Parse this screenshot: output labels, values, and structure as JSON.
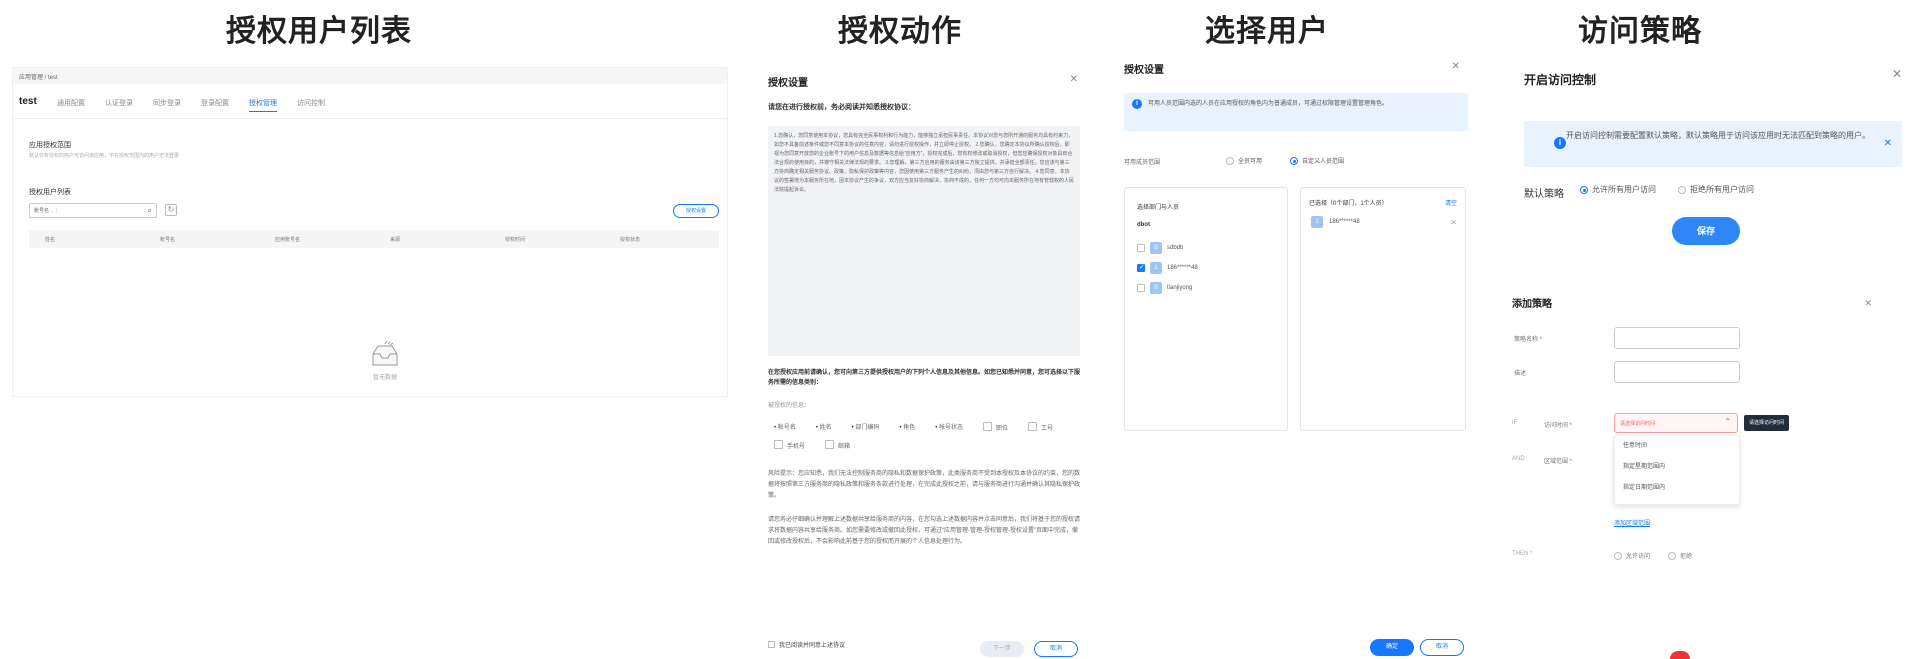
{
  "titles": {
    "p1": "授权用户列表",
    "p2": "授权动作",
    "p3": "选择用户",
    "p4": "访问策略"
  },
  "panel1": {
    "breadcrumb": "应用管理 / test",
    "app_title": "test",
    "tabs": [
      "通用配置",
      "认证登录",
      "同步登录",
      "登录配置",
      "授权管理",
      "访问控制"
    ],
    "active_tab_index": 4,
    "section_title": "应用授权范围",
    "section_desc": "默认仅有授权的用户可访问该应用，不在授权范围内的用户无法登录",
    "list_title": "授权用户列表",
    "search": {
      "filter_label": "账号名",
      "value": ""
    },
    "refresh_icon": "refresh-icon",
    "auth_button": "授权设置",
    "table_headers": [
      "姓名",
      "账号名",
      "应用账号名",
      "来源",
      "授权时间",
      "授权状态"
    ],
    "empty_text": "暂无数据"
  },
  "panel2": {
    "dialog_title": "授权设置",
    "instruction": "请您在进行授权前，务必阅读并知悉授权协议：",
    "agreement_text": "1.您确认，您同意使用本协议，您具有完全民事权利和行为能力，能够独立承担民事责任。本协议对您与您所开通的服务均具有约束力，如您不具备前述条件或您不同意本协议的任意内容，请勿进行授权操作，并立即停止授权。 2.您确认，您确定本协议所确认授权后，即视为您同意开放您的企业账号下的用户信息及数据等信息给“应用方”，授权完成后，您有权修改或取消授权，但您应确保授权对象具有合法合规的使用目的，并遵守相关法律法规的要求。 3.您理解，第三方应用的服务由该第三方独立提供，并承担全部责任，您应该与第三方协商确定相关服务协议、政策、隐私保护政策等内容，您因使用第三方服务产生的纠纷，须由您与第三方自行解决。 4.您同意，本协议的签署地为本服务所在地，因本协议产生的争议，双方应当友好协商解决，协商不成的，任何一方均可向本服务所在地有管辖权的人民法院提起诉讼。",
    "notice": "在您授权应用前请确认，您可向第三方提供授权用户的下列个人信息及其他信息。如您已知悉并同意，您可选择以下服务所需的信息类别：",
    "fields_label": "被授权的信息：",
    "fields_dot": [
      "帐号名",
      "姓名",
      "部门编码",
      "角色",
      "帐号状态"
    ],
    "fields_cb": [
      "职位",
      "工号",
      "手机号",
      "邮箱"
    ],
    "risk": "风险提示：您应知悉，我们无法控制服务商的隐私和数据保护政策，此类服务商不受到本授权及本协议的约束，您的数据将按照第三方服务商的隐私政策和服务条款进行处理，在完成此授权之前，请与服务商进行沟通并确认其隐私保护政策。",
    "confirm": "请您务必仔细确认并理解上述数据共享给服务商的内容，在您勾选上述数据内容并点击同意后，我们将基于您的授权请求将数据内容共享给服务商。如您需要修改或撤回此授权，可通过“应用管理-管理-授权管理-授权设置”页面中完成，撤回或修改授权后，不会影响此前基于您的授权而开展的个人信息处理行为。",
    "agree_checkbox": "我已阅读并同意上述协议",
    "next_button": "下一步",
    "cancel_button": "取消"
  },
  "panel3": {
    "dialog_title": "授权设置",
    "info": "可用人员范围内选的人员在应用授权的角色内为普通成员，可通过权限管理设置管理角色。",
    "range_label": "可用成员范围",
    "radio_all": "全员可用",
    "radio_custom": "自定义人员范围",
    "left_title": "选择部门与人员",
    "root": "dbot",
    "users": [
      {
        "avatar": "S",
        "name": "sdbdb",
        "checked": false
      },
      {
        "avatar": "1",
        "name": "186******48",
        "checked": true
      },
      {
        "avatar": "S",
        "name": "tianjiyong",
        "checked": false
      }
    ],
    "right_head": "已选择（0个部门，1个人员）",
    "clear": "清空",
    "selected": {
      "avatar": "1",
      "name": "186******48"
    },
    "ok_button": "确定",
    "cancel_button": "取消"
  },
  "panel4": {
    "title": "开启访问控制",
    "info": "开启访问控制需要配置默认策略，默认策略用于访问该应用时无法匹配到策略的用户。",
    "default_label": "默认策略",
    "radio_allow_all": "允许所有用户访问",
    "radio_deny_all": "拒绝所有用户访问",
    "save_button": "保存",
    "add_policy_title": "添加策略",
    "policy_name_label": "策略名称 *",
    "desc_label": "描述",
    "if_label": "IF",
    "time_label": "访问时间 *",
    "time_placeholder": "请选择访问时间",
    "tooltip": "请选择访问时间",
    "time_options": [
      "任意时间",
      "指定星期范围内",
      "指定日期范围内"
    ],
    "and_label": "AND",
    "region_label": "区域范围 *",
    "add_region": "添加区域范围",
    "then_label": "THEN *",
    "then_allow": "允许访问",
    "then_deny": "拒绝"
  }
}
